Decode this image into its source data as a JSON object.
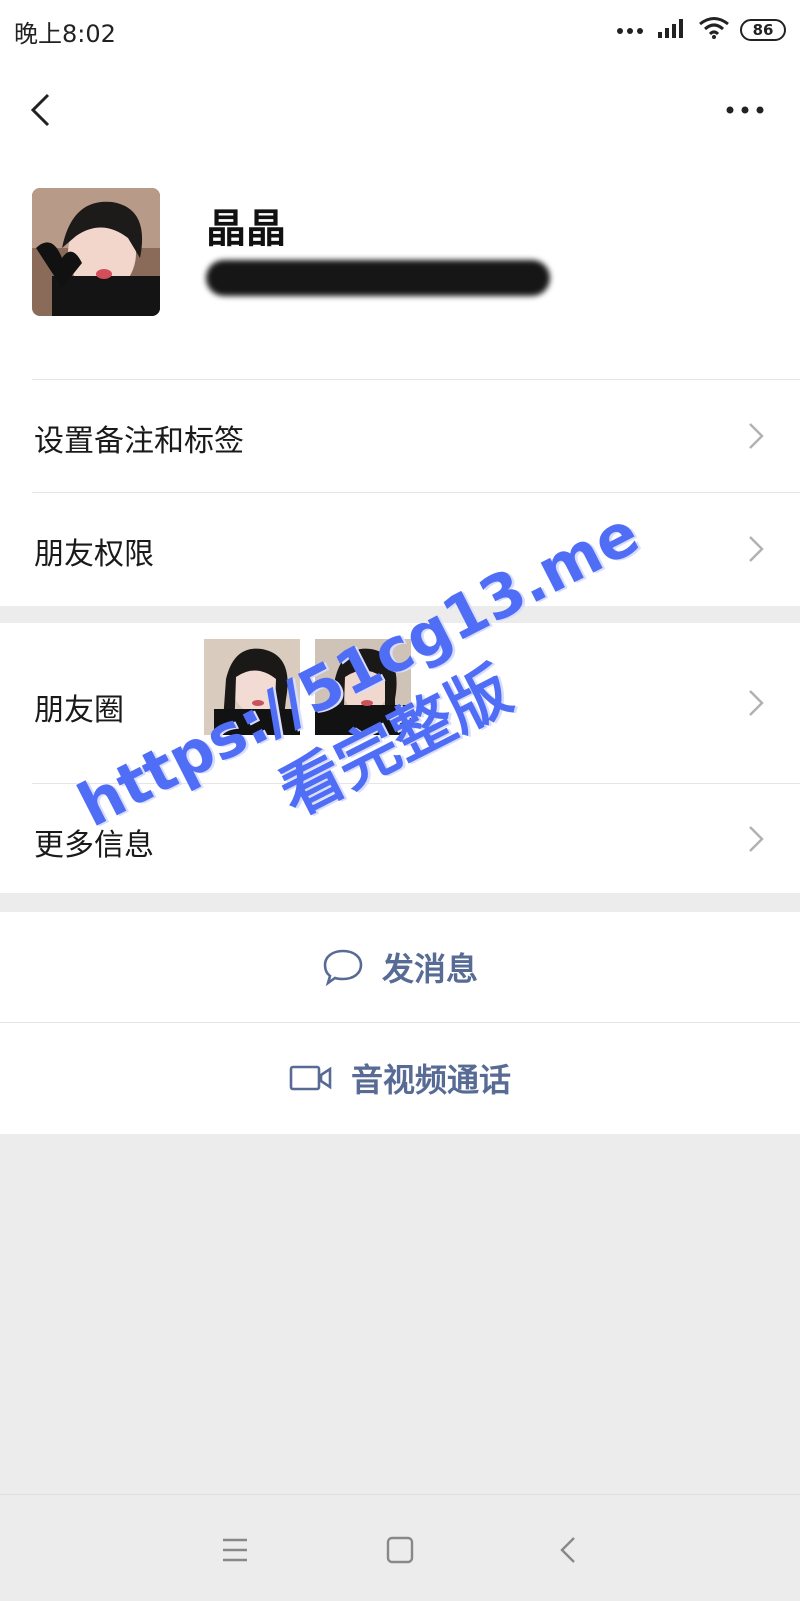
{
  "status_bar": {
    "time": "晚上8:02",
    "battery": "86"
  },
  "profile": {
    "name": "晶晶"
  },
  "menu": {
    "set_remark": "设置备注和标签",
    "friend_permissions": "朋友权限",
    "moments": "朋友圈",
    "more_info": "更多信息"
  },
  "actions": {
    "send_message": "发消息",
    "video_call": "音视频通话"
  },
  "watermark": {
    "url": "https://51cg13.me",
    "text": "看完整版"
  },
  "colors": {
    "accent": "#576b95",
    "watermark": "#4f6ef5",
    "background": "#ececec"
  },
  "icons": [
    "back-chevron-icon",
    "more-dots-icon",
    "chevron-right-icon",
    "chat-bubble-icon",
    "video-camera-icon",
    "menu-lines-icon",
    "home-square-icon",
    "back-triangle-icon"
  ]
}
